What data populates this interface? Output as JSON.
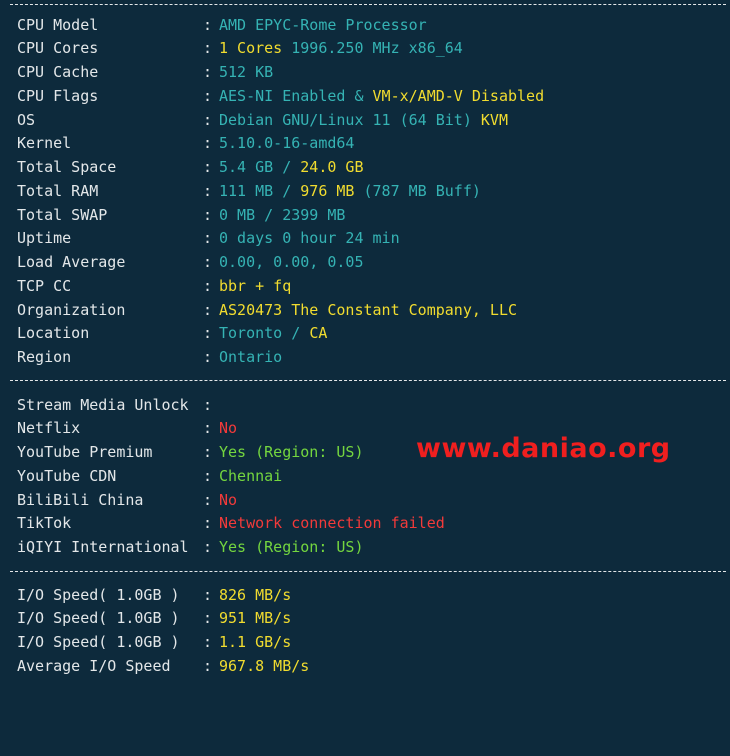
{
  "system": {
    "cpu_model": {
      "label": "CPU Model",
      "value": "AMD EPYC-Rome Processor"
    },
    "cpu_cores": {
      "label": "CPU Cores",
      "count": "1 Cores",
      "freq": "1996.250 MHz x86_64"
    },
    "cpu_cache": {
      "label": "CPU Cache",
      "value": "512 KB"
    },
    "cpu_flags": {
      "label": "CPU Flags",
      "aes": "AES-NI Enabled & ",
      "vmx": "VM-x/AMD-V Disabled"
    },
    "os": {
      "label": "OS",
      "value": "Debian GNU/Linux 11 (64 Bit) ",
      "virt": "KVM"
    },
    "kernel": {
      "label": "Kernel",
      "value": "5.10.0-16-amd64"
    },
    "total_space": {
      "label": "Total Space",
      "used": "5.4 GB / ",
      "total": "24.0 GB"
    },
    "total_ram": {
      "label": "Total RAM",
      "used": "111 MB / ",
      "total": "976 MB",
      "buff": " (787 MB Buff)"
    },
    "total_swap": {
      "label": "Total SWAP",
      "value": "0 MB / 2399 MB"
    },
    "uptime": {
      "label": "Uptime",
      "value": "0 days 0 hour 24 min"
    },
    "load_average": {
      "label": "Load Average",
      "value": "0.00, 0.00, 0.05"
    },
    "tcp_cc": {
      "label": "TCP CC",
      "value": "bbr + fq"
    },
    "organization": {
      "label": "Organization",
      "value": "AS20473 The Constant Company, LLC"
    },
    "location": {
      "label": "Location",
      "city": "Toronto / ",
      "country": "CA"
    },
    "region": {
      "label": "Region",
      "value": "Ontario"
    }
  },
  "stream": {
    "header": {
      "label": "Stream Media Unlock"
    },
    "netflix": {
      "label": "Netflix",
      "value": "No"
    },
    "youtube_premium": {
      "label": "YouTube Premium",
      "value": "Yes (Region: US)"
    },
    "youtube_cdn": {
      "label": "YouTube CDN",
      "value": "Chennai"
    },
    "bilibili": {
      "label": "BiliBili China",
      "value": "No"
    },
    "tiktok": {
      "label": "TikTok",
      "value": "Network connection failed"
    },
    "iqiyi": {
      "label": "iQIYI International",
      "value": "Yes (Region: US)"
    }
  },
  "io": {
    "run1": {
      "label": "I/O Speed( 1.0GB )",
      "value": "826 MB/s"
    },
    "run2": {
      "label": "I/O Speed( 1.0GB )",
      "value": "951 MB/s"
    },
    "run3": {
      "label": "I/O Speed( 1.0GB )",
      "value": "1.1 GB/s"
    },
    "average": {
      "label": "Average I/O Speed",
      "value": "967.8 MB/s"
    }
  },
  "separator_colon": ":",
  "watermark": "www.daniao.org"
}
